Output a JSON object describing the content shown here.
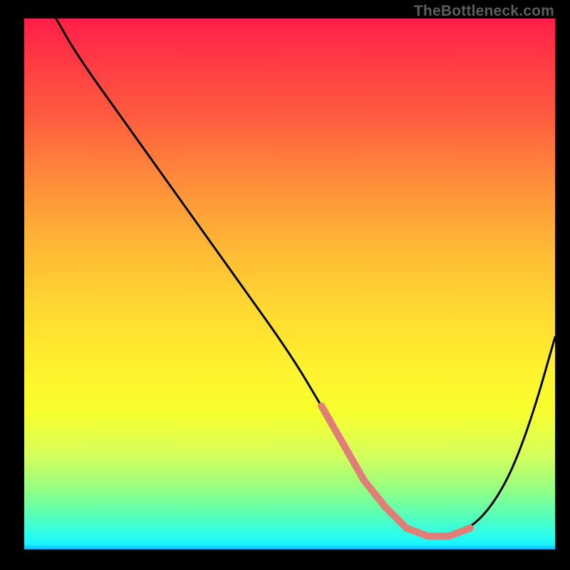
{
  "attribution": "TheBottleneck.com",
  "chart_data": {
    "type": "line",
    "title": "",
    "xlabel": "",
    "ylabel": "",
    "xlim": [
      0,
      100
    ],
    "ylim": [
      0,
      100
    ],
    "x": [
      6,
      10,
      20,
      30,
      40,
      50,
      56,
      60,
      64,
      68,
      72,
      76,
      80,
      84,
      88,
      92,
      96,
      100
    ],
    "values": [
      100,
      93,
      79,
      65,
      51,
      37,
      27,
      20,
      13,
      8,
      4,
      2.5,
      2.5,
      4,
      8,
      15,
      26,
      40
    ],
    "highlight_range_x": [
      56,
      84
    ],
    "colors": {
      "curve": "#000000",
      "marker": "#e07f77",
      "gradient_top": "#ff1f47",
      "gradient_bottom": "#0fb7ff"
    }
  }
}
